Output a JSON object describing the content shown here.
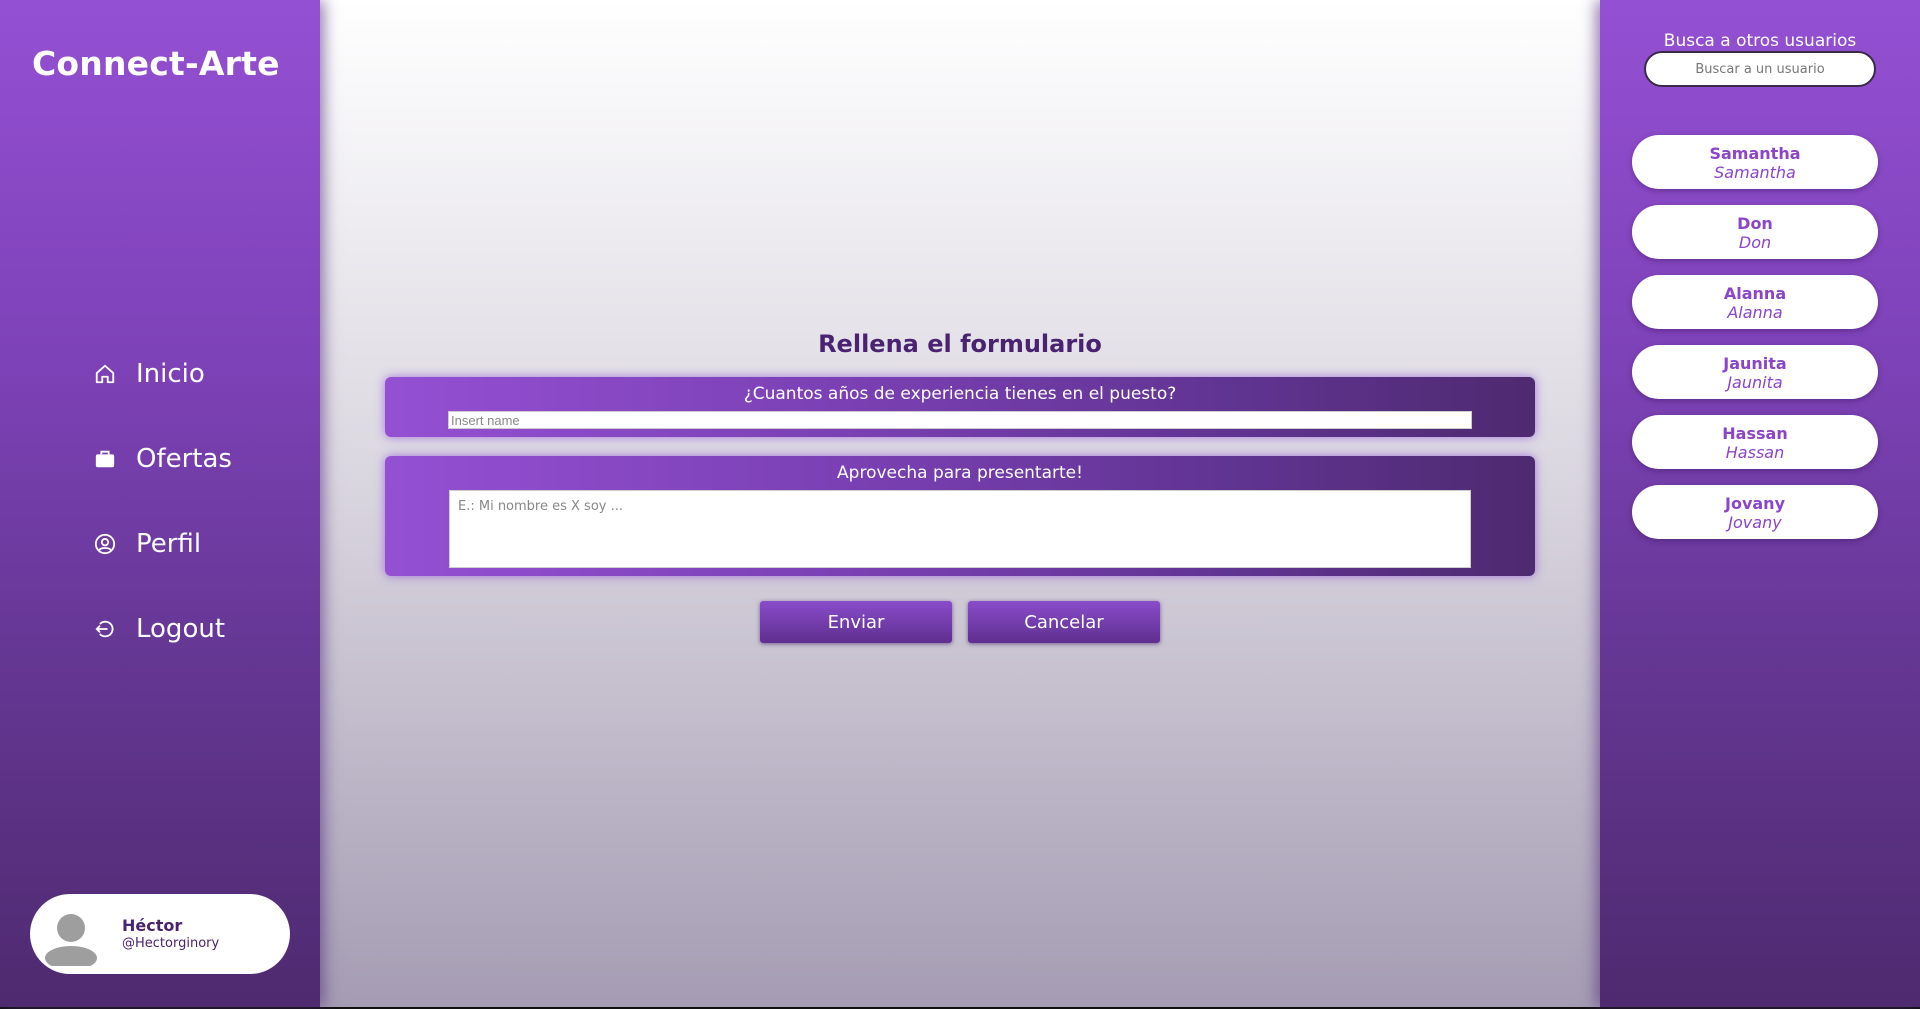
{
  "brand": "Connect-Arte",
  "nav": {
    "inicio": "Inicio",
    "ofertas": "Ofertas",
    "perfil": "Perfil",
    "logout": "Logout"
  },
  "current_user": {
    "name": "Héctor",
    "handle": "@Hectorginory"
  },
  "form": {
    "title": "Rellena el formulario",
    "q1_label": "¿Cuantos años de experiencia tienes en el puesto?",
    "q1_placeholder": "Insert name",
    "q2_label": "Aprovecha para presentarte!",
    "q2_placeholder": "E.: Mi nombre es X soy ...",
    "send_label": "Enviar",
    "cancel_label": "Cancelar"
  },
  "search": {
    "title": "Busca a otros usuarios",
    "placeholder": "Buscar a un usuario"
  },
  "users": [
    {
      "name": "Samantha",
      "handle": "Samantha"
    },
    {
      "name": "Don",
      "handle": "Don"
    },
    {
      "name": "Alanna",
      "handle": "Alanna"
    },
    {
      "name": "Jaunita",
      "handle": "Jaunita"
    },
    {
      "name": "Hassan",
      "handle": "Hassan"
    },
    {
      "name": "Jovany",
      "handle": "Jovany"
    }
  ],
  "colors": {
    "sidebar_top": "#9450d3",
    "sidebar_bottom": "#4e2a6f",
    "title_text": "#4a2370",
    "user_pill_text": "#8a45c8"
  }
}
